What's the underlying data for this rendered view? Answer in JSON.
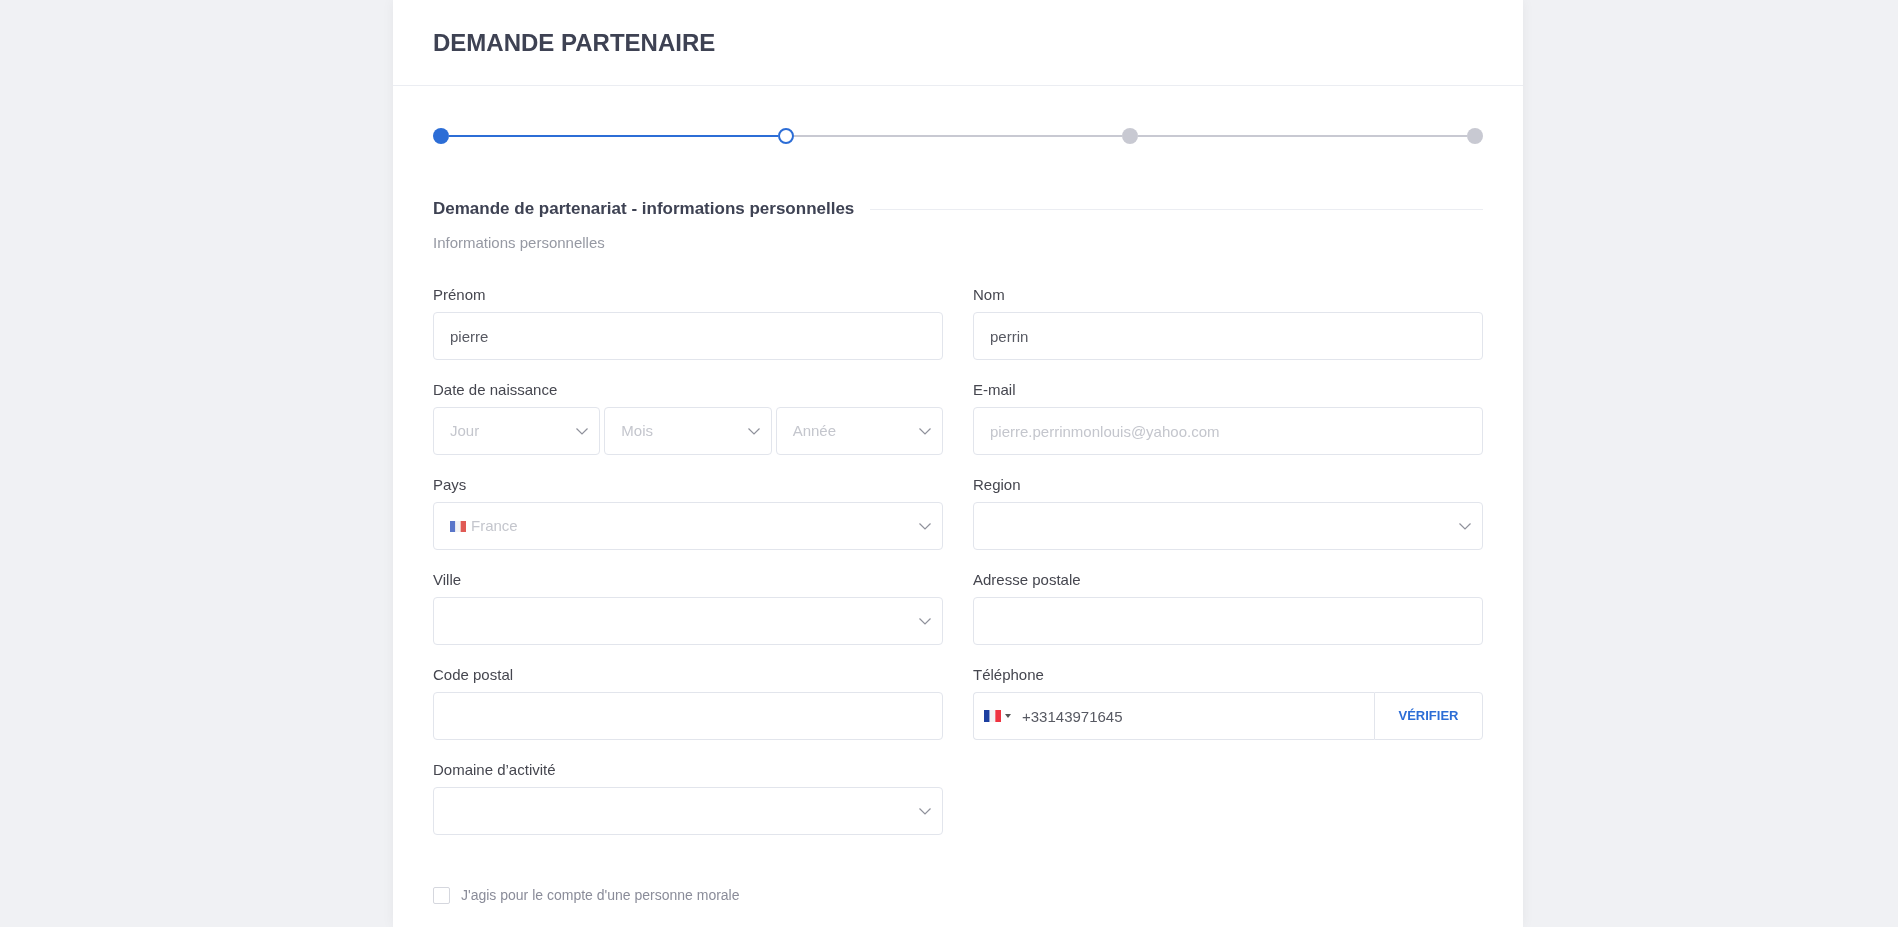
{
  "header": {
    "title": "DEMANDE PARTENAIRE"
  },
  "stepper": {
    "steps": [
      {
        "completed": true,
        "selected": false
      },
      {
        "completed": false,
        "selected": true
      },
      {
        "completed": false,
        "selected": false
      },
      {
        "completed": false,
        "selected": false
      }
    ]
  },
  "section": {
    "title": "Demande de partenariat - informations personnelles",
    "subtitle": "Informations personnelles"
  },
  "fields": [
    {
      "kind": "text",
      "label": "Prénom",
      "value": "pierre"
    },
    {
      "kind": "text",
      "label": "Nom",
      "value": "perrin"
    },
    {
      "kind": "date",
      "label": "Date de naissance",
      "parts": [
        {
          "placeholder": "Jour"
        },
        {
          "placeholder": "Mois"
        },
        {
          "placeholder": "Année"
        }
      ]
    },
    {
      "kind": "text",
      "label": "E-mail",
      "placeholder": "pierre.perrinmonlouis@yahoo.com"
    },
    {
      "kind": "country",
      "label": "Pays",
      "placeholder": "France"
    },
    {
      "kind": "select",
      "label": "Region"
    },
    {
      "kind": "select",
      "label": "Ville"
    },
    {
      "kind": "text",
      "label": "Adresse postale"
    },
    {
      "kind": "text",
      "label": "Code postal"
    },
    {
      "kind": "phone",
      "label": "Téléphone",
      "value": "+33143971645",
      "button": "VÉRIFIER"
    },
    {
      "kind": "select",
      "label": "Domaine d’activité"
    }
  ],
  "agreement": {
    "label": "J'agis pour le compte d'une personne morale",
    "checked": false
  }
}
